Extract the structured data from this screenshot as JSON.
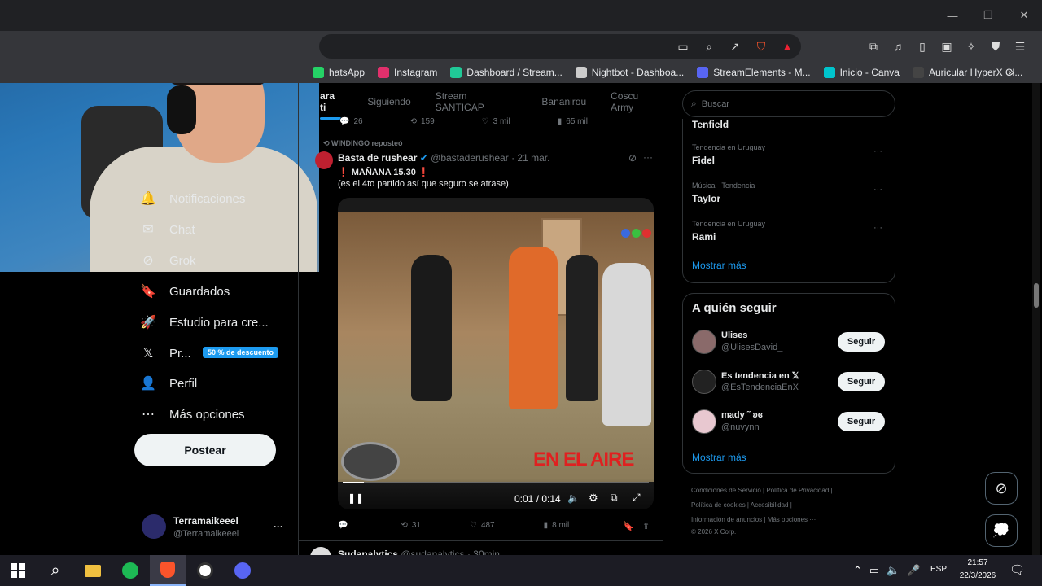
{
  "browser": {
    "window_controls": {
      "minimize": "—",
      "maximize": "❐",
      "close": "✕"
    },
    "bookmarks": [
      {
        "label": "hatsApp",
        "color": "#25d366"
      },
      {
        "label": "Instagram",
        "color": "#e1306c"
      },
      {
        "label": "Dashboard / Stream...",
        "color": "#20c997"
      },
      {
        "label": "Nightbot - Dashboa...",
        "color": "#cccccc"
      },
      {
        "label": "StreamElements - M...",
        "color": "#5865f2"
      },
      {
        "label": "Inicio - Canva",
        "color": "#00c4cc"
      },
      {
        "label": "Auricular HyperX Cl...",
        "color": "#444444"
      }
    ],
    "bookmarks_more": "»"
  },
  "left_nav": {
    "items": [
      {
        "label": "Notificaciones",
        "icon": "bell-icon",
        "glyph": "🔔"
      },
      {
        "label": "Chat",
        "icon": "mail-icon",
        "glyph": "✉"
      },
      {
        "label": "Grok",
        "icon": "grok-icon",
        "glyph": "⊘"
      },
      {
        "label": "Guardados",
        "icon": "bookmark-icon",
        "glyph": "🔖"
      },
      {
        "label": "Estudio para cre...",
        "icon": "rocket-icon",
        "glyph": "🚀"
      },
      {
        "label": "Pr...",
        "icon": "x-logo-icon",
        "glyph": "𝕏"
      },
      {
        "label": "Perfil",
        "icon": "person-icon",
        "glyph": "👤"
      },
      {
        "label": "Más opciones",
        "icon": "more-circle-icon",
        "glyph": "⋯"
      }
    ],
    "premium_badge": "50 % de descuento",
    "post_button": "Postear",
    "account": {
      "name": "Terramaikeeel",
      "handle": "@Terramaikeeel",
      "more": "···"
    }
  },
  "timeline": {
    "tabs": [
      "ara ti",
      "Siguiendo",
      "Stream SANTICAP",
      "Bananirou",
      "Coscu Army"
    ],
    "prev_actions": {
      "replies": "26",
      "reposts": "159",
      "likes": "3 mil",
      "views": "65 mil"
    },
    "post": {
      "repost_note": "WINDINGO reposteó",
      "author": "Basta de rushear",
      "handle": "@bastaderushear",
      "time": "· 21 mar.",
      "line1": "❗ MAÑANA 15.30 ❗",
      "line2": "(es el 4to partido así que seguro se atrase)",
      "video": {
        "time": "0:01 / 0:14",
        "progress": 0.07,
        "overlay_text": "EN EL AIRE"
      },
      "actions": {
        "replies": "",
        "reposts": "31",
        "likes": "487",
        "views": "8 mil"
      }
    },
    "next_post": {
      "author": "Sudanalytics",
      "handle": "@sudanalytics",
      "time": "· 30min"
    }
  },
  "sidebar": {
    "search_placeholder": "Buscar",
    "trends_top": "Tenfield",
    "trends": [
      {
        "context": "Tendencia en Uruguay",
        "name": "Fidel"
      },
      {
        "context": "Música · Tendencia",
        "name": "Taylor"
      },
      {
        "context": "Tendencia en Uruguay",
        "name": "Rami"
      }
    ],
    "show_more": "Mostrar más",
    "who_to_follow_title": "A quién seguir",
    "follow": [
      {
        "name": "Ulises",
        "handle": "@UlisesDavid_",
        "button": "Seguir",
        "color": "#8a6a6a"
      },
      {
        "name": "Es tendencia en 𝕏",
        "handle": "@EsTendenciaEnX",
        "button": "Seguir",
        "color": "#222222"
      },
      {
        "name": "mady ˜ ʚɞ",
        "handle": "@nuvynn",
        "button": "Seguir",
        "color": "#e8c8d0"
      }
    ],
    "show_more_2": "Mostrar más",
    "footer": {
      "line1": "Condiciones de Servicio  |  Política de Privacidad  |",
      "line2": "Política de cookies  |  Accesibilidad  |",
      "line3": "Información de anuncios  |  Más opciones ···",
      "line4": "© 2026 X Corp."
    }
  },
  "taskbar": {
    "lang": "ESP",
    "time": "21:57",
    "date": "22/3/2026"
  },
  "colors": {
    "accent": "#1d9bf0",
    "background": "#000000",
    "border": "#2f3336"
  }
}
